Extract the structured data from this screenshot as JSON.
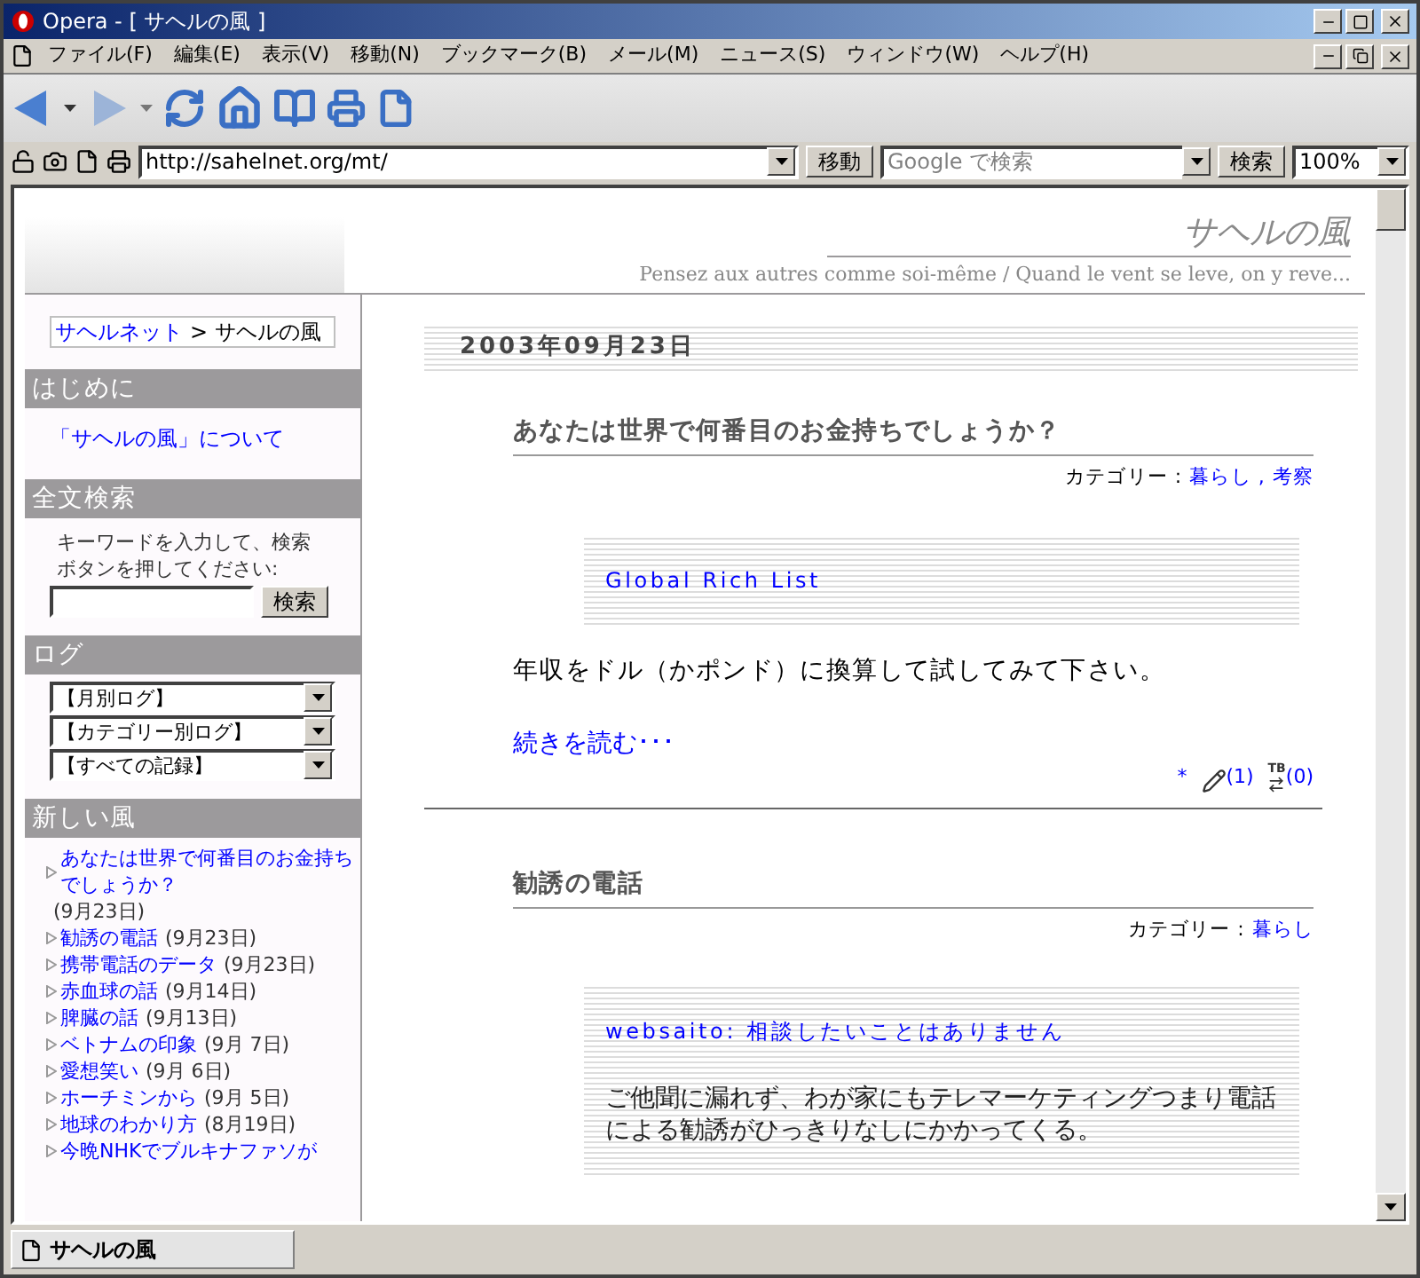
{
  "window": {
    "title": "Opera - [ サヘルの風 ]"
  },
  "menu": [
    {
      "label": "ファイル(F)"
    },
    {
      "label": "編集(E)"
    },
    {
      "label": "表示(V)"
    },
    {
      "label": "移動(N)"
    },
    {
      "label": "ブックマーク(B)"
    },
    {
      "label": "メール(M)"
    },
    {
      "label": "ニュース(S)"
    },
    {
      "label": "ウィンドウ(W)"
    },
    {
      "label": "ヘルプ(H)"
    }
  ],
  "address_bar": {
    "url": "http://sahelnet.org/mt/",
    "go_button": "移動",
    "search_placeholder": "Google で検索",
    "search_button": "検索",
    "zoom": "100%"
  },
  "page": {
    "site_title": "サヘルの風",
    "tagline": "Pensez aux autres comme soi-même / Quand le vent se leve, on y reve...",
    "breadcrumb": {
      "link": "サヘルネット",
      "separator": ">",
      "current": "サヘルの風"
    },
    "sidebar": [
      {
        "kind": "links",
        "heading": "はじめに",
        "links": [
          "「サヘルの風」について"
        ]
      },
      {
        "kind": "search",
        "heading": "全文検索",
        "instructions": "キーワードを入力して、検索ボタンを押してください:",
        "button": "検索"
      },
      {
        "kind": "selects",
        "heading": "ログ",
        "selects": [
          "【月別ログ】",
          "【カテゴリー別ログ】",
          "【すべての記録】"
        ]
      },
      {
        "kind": "entries",
        "heading": "新しい風",
        "entries": [
          {
            "title": "あなたは世界で何番目のお金持ちでしょうか？",
            "date": "(9月23日)"
          },
          {
            "title": "勧誘の電話",
            "date": "(9月23日)"
          },
          {
            "title": "携帯電話のデータ",
            "date": "(9月23日)"
          },
          {
            "title": "赤血球の話",
            "date": "(9月14日)"
          },
          {
            "title": "脾臓の話",
            "date": "(9月13日)"
          },
          {
            "title": "ベトナムの印象",
            "date": "(9月 7日)"
          },
          {
            "title": "愛想笑い",
            "date": "(9月 6日)"
          },
          {
            "title": "ホーチミンから",
            "date": "(9月 5日)"
          },
          {
            "title": "地球のわかり方",
            "date": "(8月19日)"
          },
          {
            "title": "今晩NHKでブルキナファソが"
          }
        ]
      }
    ],
    "date": "2003年09月23日",
    "posts": [
      {
        "title": "あなたは世界で何番目のお金持ちでしょうか？",
        "category_label": "カテゴリー :",
        "categories": [
          "暮らし",
          "考察"
        ],
        "category_separator": ",",
        "quote": {
          "link": "Global Rich List"
        },
        "body": "年収をドル（かポンド）に換算して試してみて下さい。",
        "read_more": "続きを読む･･･",
        "footer": {
          "permalink": "*",
          "comments": "(1)",
          "trackback_mark": "TB",
          "trackbacks": "(0)"
        }
      },
      {
        "title": "勧誘の電話",
        "category_label": "カテゴリー :",
        "categories": [
          "暮らし"
        ],
        "quote": {
          "link": "websaito: 相談したいことはありません",
          "text": "ご他聞に漏れず、わが家にもテレマーケティングつまり電話による勧誘がひっきりなしにかかってくる。"
        }
      }
    ]
  },
  "status_bar": {
    "tab": "サヘルの風"
  }
}
